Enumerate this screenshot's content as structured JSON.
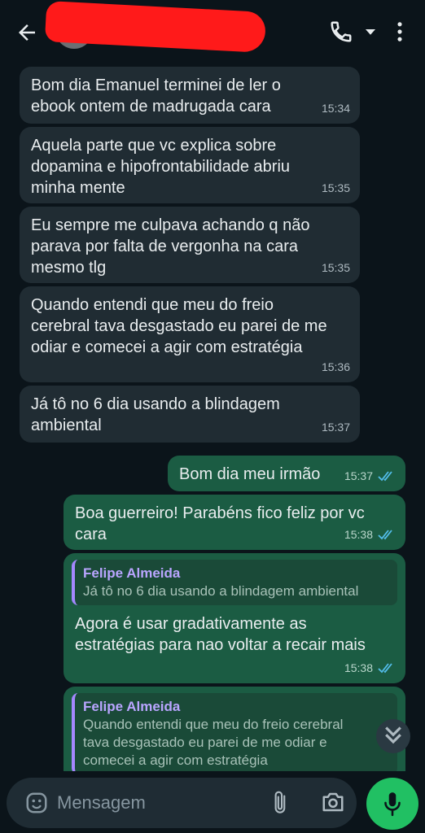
{
  "header": {
    "contact_name": ""
  },
  "messages": [
    {
      "direction": "in",
      "text": "Bom dia Emanuel terminei de ler o\nebook ontem de madrugada cara",
      "time": "15:34"
    },
    {
      "direction": "in",
      "text": "Aquela parte que vc explica sobre\ndopamina e hipofrontabilidade abriu\nminha mente",
      "time": "15:35"
    },
    {
      "direction": "in",
      "text": "Eu sempre me culpava achando q não\nparava por falta de vergonha na cara\nmesmo tlg",
      "time": "15:35"
    },
    {
      "direction": "in",
      "text": "Quando entendi que meu do freio\ncerebral tava desgastado eu parei de me\nodiar e comecei a agir com estratégia",
      "time": "15:36"
    },
    {
      "direction": "in",
      "text": "Já tô no 6 dia usando a blindagem\nambiental",
      "time": "15:37"
    },
    {
      "direction": "out",
      "text": "Bom dia meu irmão",
      "time": "15:37"
    },
    {
      "direction": "out",
      "text": "Boa guerreiro! Parabéns fico feliz por vc\ncara",
      "time": "15:38"
    },
    {
      "direction": "out",
      "quote_name": "Felipe Almeida",
      "quote_text": "Já tô no 6 dia usando a blindagem ambiental",
      "text": "Agora é usar gradativamente as\nestratégias para nao voltar a recair mais",
      "time": "15:38"
    },
    {
      "direction": "out",
      "quote_name": "Felipe Almeida",
      "quote_text": "Quando entendi que meu do freio cerebral\ntava desgastado eu parei de me odiar e\ncomecei a agir com estratégia",
      "text": "",
      "time": ""
    }
  ],
  "composer": {
    "placeholder": "Mensagem"
  },
  "colors": {
    "background": "#0b141a",
    "incoming_bubble": "#202c33",
    "outgoing_bubble": "#1b5c43",
    "read_ticks": "#53bdeb",
    "mic_button": "#21c063",
    "quote_accent": "#a587ff"
  },
  "icons": [
    "arrow-back-icon",
    "phone-icon",
    "caret-down-icon",
    "more-vert-icon",
    "double-check-icon",
    "chevron-double-down-icon",
    "emoji-icon",
    "paperclip-icon",
    "camera-icon",
    "microphone-icon"
  ]
}
